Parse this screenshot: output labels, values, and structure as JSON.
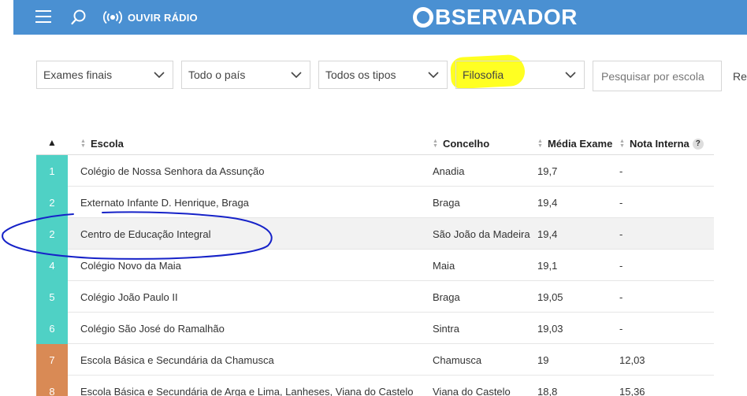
{
  "header": {
    "radio_label": "OUVIR RÁDIO",
    "logo_text": "BSERVADOR",
    "brand_color": "#4a90d2"
  },
  "filters": {
    "exam": "Exames finais",
    "region": "Todo o país",
    "type": "Todos os tipos",
    "subject": "Filosofia",
    "search_placeholder": "Pesquisar por escola",
    "reset_label": "Res"
  },
  "table": {
    "headers": {
      "rank_sort": "▲",
      "school": "Escola",
      "municipality": "Concelho",
      "exam_avg": "Média Exame",
      "internal_grade": "Nota Interna",
      "help": "?"
    },
    "rows": [
      {
        "rank": "1",
        "school": "Colégio de Nossa Senhora da Assunção",
        "municipality": "Anadia",
        "exam_avg": "19,7",
        "internal_grade": "-",
        "color": "#4fd1c5"
      },
      {
        "rank": "2",
        "school": "Externato Infante D. Henrique, Braga",
        "municipality": "Braga",
        "exam_avg": "19,4",
        "internal_grade": "-",
        "color": "#4fd1c5"
      },
      {
        "rank": "2",
        "school": "Centro de Educação Integral",
        "municipality": "São João da Madeira",
        "exam_avg": "19,4",
        "internal_grade": "-",
        "color": "#4fd1c5"
      },
      {
        "rank": "4",
        "school": "Colégio Novo da Maia",
        "municipality": "Maia",
        "exam_avg": "19,1",
        "internal_grade": "-",
        "color": "#4fd1c5"
      },
      {
        "rank": "5",
        "school": "Colégio João Paulo II",
        "municipality": "Braga",
        "exam_avg": "19,05",
        "internal_grade": "-",
        "color": "#4fd1c5"
      },
      {
        "rank": "6",
        "school": "Colégio São José do Ramalhão",
        "municipality": "Sintra",
        "exam_avg": "19,03",
        "internal_grade": "-",
        "color": "#4fd1c5"
      },
      {
        "rank": "7",
        "school": "Escola Básica e Secundária da Chamusca",
        "municipality": "Chamusca",
        "exam_avg": "19",
        "internal_grade": "12,03",
        "color": "#d98a55"
      },
      {
        "rank": "8",
        "school": "Escola Básica e Secundária de Arga e Lima, Lanheses, Viana do Castelo",
        "municipality": "Viana do Castelo",
        "exam_avg": "18,8",
        "internal_grade": "15,36",
        "color": "#d98a55"
      }
    ]
  }
}
